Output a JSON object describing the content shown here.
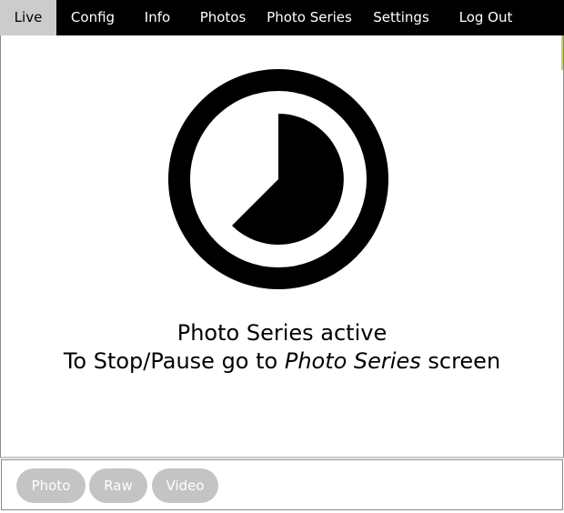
{
  "nav": {
    "items": [
      {
        "label": "Live"
      },
      {
        "label": "Config"
      },
      {
        "label": "Info"
      },
      {
        "label": "Photos"
      },
      {
        "label": "Photo Series"
      },
      {
        "label": "Settings"
      },
      {
        "label": "Log Out"
      }
    ],
    "active": "Live"
  },
  "status": {
    "icon": "timer-icon",
    "line1": "Photo Series active",
    "line2_prefix": "To Stop/Pause go to ",
    "line2_emphasis": "Photo Series",
    "line2_suffix": " screen"
  },
  "footer": {
    "buttons": [
      {
        "label": "Photo"
      },
      {
        "label": "Raw"
      },
      {
        "label": "Video"
      }
    ]
  },
  "colors": {
    "nav_background": "#000000",
    "active_tab": "#cccccc",
    "button_background": "#c4c4c4",
    "button_text": "#ffffff"
  }
}
